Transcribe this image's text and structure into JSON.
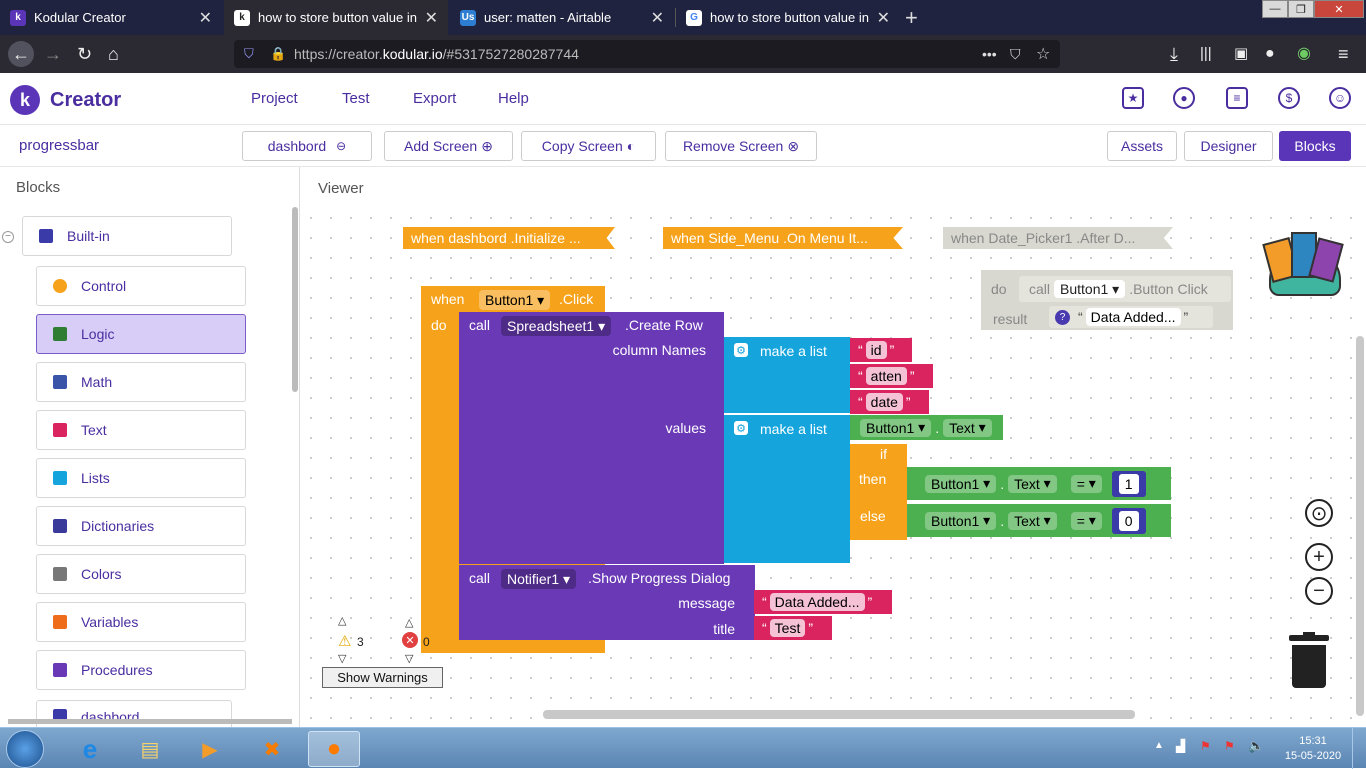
{
  "browser": {
    "tabs": [
      {
        "title": "Kodular Creator",
        "fav": "k",
        "active": false
      },
      {
        "title": "how to store button value in da",
        "fav": "k",
        "active": true
      },
      {
        "title": "user: matten - Airtable",
        "fav": "Us",
        "active": false
      },
      {
        "title": "how to store button value in da",
        "fav": "G",
        "active": false
      }
    ],
    "url_prefix": "https://creator.",
    "url_domain": "kodular.io",
    "url_suffix": "/#5317527280287744"
  },
  "header": {
    "app_name": "Creator",
    "menu": [
      "Project",
      "Test",
      "Export",
      "Help"
    ]
  },
  "subbar": {
    "project": "progressbar",
    "screen_select": "dashbord",
    "add_screen": "Add Screen",
    "copy_screen": "Copy Screen",
    "remove_screen": "Remove Screen",
    "assets": "Assets",
    "designer": "Designer",
    "blocks": "Blocks"
  },
  "blocks_panel": {
    "title": "Blocks",
    "root": "Built-in",
    "items": [
      {
        "label": "Control",
        "color": "#f6a21a"
      },
      {
        "label": "Logic",
        "color": "#2f7d32"
      },
      {
        "label": "Math",
        "color": "#3a54a8"
      },
      {
        "label": "Text",
        "color": "#d92460"
      },
      {
        "label": "Lists",
        "color": "#15a5dc"
      },
      {
        "label": "Dictionaries",
        "color": "#3a3a9a"
      },
      {
        "label": "Colors",
        "color": "#777777"
      },
      {
        "label": "Variables",
        "color": "#ef6c1a"
      },
      {
        "label": "Procedures",
        "color": "#6a3ab6"
      }
    ],
    "next_item": "dashbord"
  },
  "viewer": {
    "title": "Viewer",
    "collapsed": [
      {
        "when": "when",
        "text": "dashbord .Initialize ..."
      },
      {
        "when": "when",
        "text": "Side_Menu .On Menu It..."
      },
      {
        "when": "when",
        "text": "Date_Picker1 .After D..."
      }
    ],
    "disabled_block": {
      "do": "do",
      "call": "call",
      "component": "Button1",
      "method": ".Button Click",
      "result": "result",
      "text": "Data Added..."
    },
    "event": {
      "when": "when",
      "component": "Button1",
      "event": ".Click",
      "do": "do"
    },
    "create_row": {
      "call": "call",
      "component": "Spreadsheet1",
      "method": ".Create Row",
      "column_names": "column Names",
      "values": "values",
      "make_list": "make a list",
      "columns": [
        "id",
        "atten",
        "date"
      ],
      "value_component": "Button1",
      "value_property": "Text",
      "if": "if",
      "then": "then",
      "else": "else",
      "cmp_component": "Button1",
      "cmp_property": "Text",
      "op": "=",
      "then_value": "1",
      "else_value": "0"
    },
    "notifier": {
      "call": "call",
      "component": "Notifier1",
      "method": ".Show Progress Dialog",
      "message_label": "message",
      "message": "Data Added...",
      "title_label": "title",
      "title": "Test"
    },
    "warnings": "3",
    "errors": "0",
    "show_warnings": "Show Warnings"
  },
  "taskbar": {
    "time": "15:31",
    "date": "15-05-2020"
  }
}
